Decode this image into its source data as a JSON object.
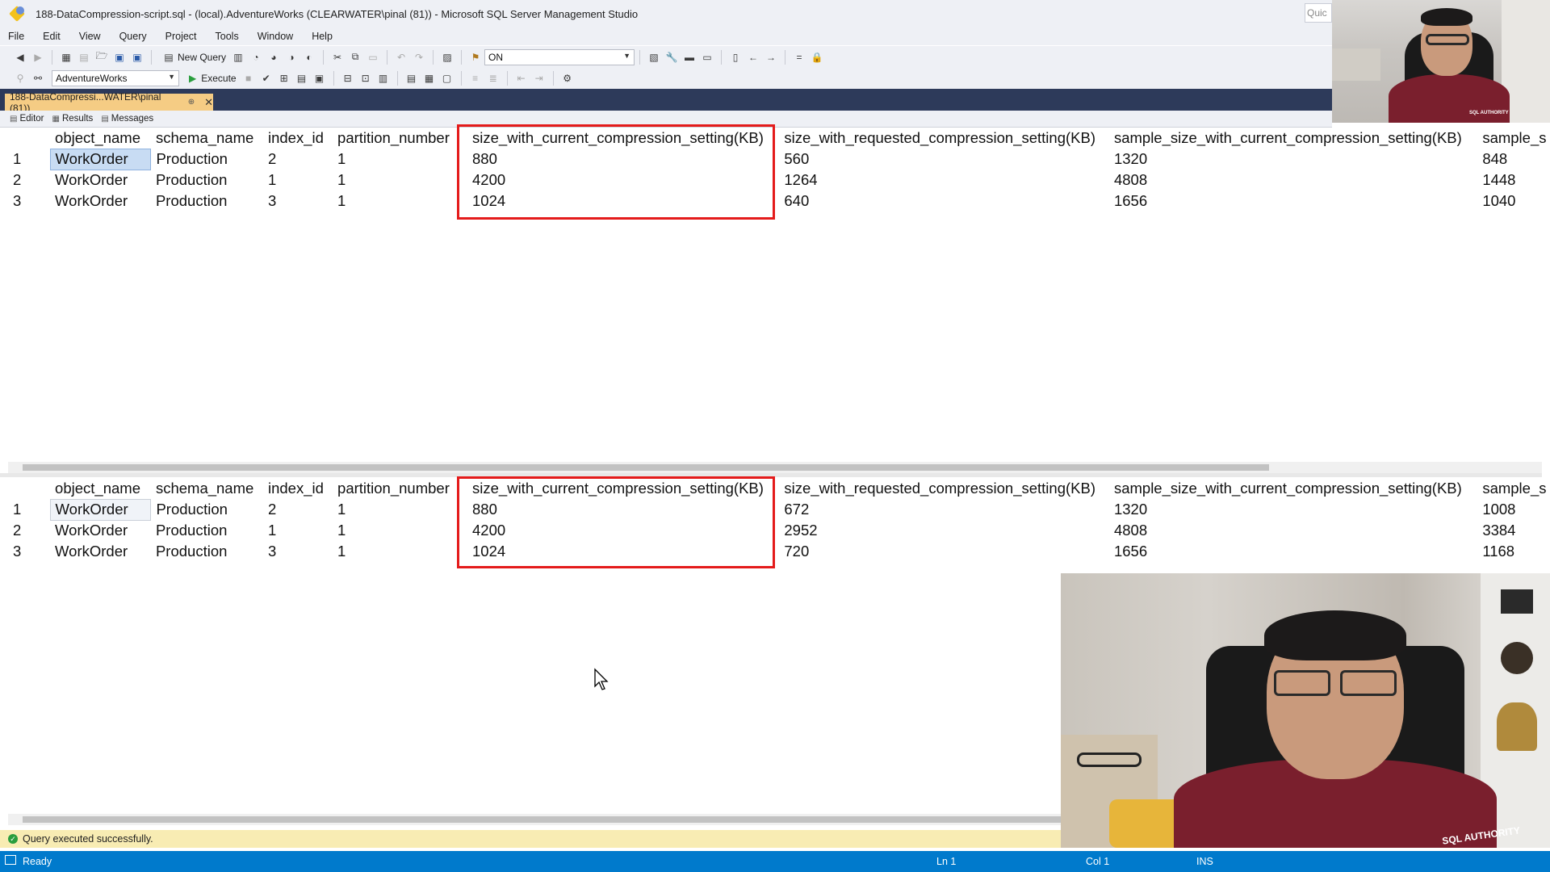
{
  "window": {
    "title": "188-DataCompression-script.sql - (local).AdventureWorks (CLEARWATER\\pinal (81)) - Microsoft SQL Server Management Studio",
    "quick_launch": "Quic"
  },
  "menu": [
    "File",
    "Edit",
    "View",
    "Query",
    "Project",
    "Tools",
    "Window",
    "Help"
  ],
  "toolbar": {
    "new_query_label": "New Query",
    "solution_config_value": "ON",
    "database_value": "AdventureWorks",
    "execute_label": "Execute"
  },
  "doc_tab": {
    "label": "188-DataCompressi...WATER\\pinal (81))",
    "pin": "⊕",
    "close": "✕"
  },
  "sub_tabs": {
    "editor": "Editor",
    "results": "Results",
    "messages": "Messages"
  },
  "grid1": {
    "columns": [
      "object_name",
      "schema_name",
      "index_id",
      "partition_number",
      "size_with_current_compression_setting(KB)",
      "size_with_requested_compression_setting(KB)",
      "sample_size_with_current_compression_setting(KB)",
      "sample_s"
    ],
    "rows": [
      {
        "n": "1",
        "object_name": "WorkOrder",
        "schema_name": "Production",
        "index_id": "2",
        "partition_number": "1",
        "current": "880",
        "requested": "560",
        "sample_current": "1320",
        "sample_s": "848"
      },
      {
        "n": "2",
        "object_name": "WorkOrder",
        "schema_name": "Production",
        "index_id": "1",
        "partition_number": "1",
        "current": "4200",
        "requested": "1264",
        "sample_current": "4808",
        "sample_s": "1448"
      },
      {
        "n": "3",
        "object_name": "WorkOrder",
        "schema_name": "Production",
        "index_id": "3",
        "partition_number": "1",
        "current": "1024",
        "requested": "640",
        "sample_current": "1656",
        "sample_s": "1040"
      }
    ]
  },
  "grid2": {
    "columns": [
      "object_name",
      "schema_name",
      "index_id",
      "partition_number",
      "size_with_current_compression_setting(KB)",
      "size_with_requested_compression_setting(KB)",
      "sample_size_with_current_compression_setting(KB)",
      "sample_s"
    ],
    "rows": [
      {
        "n": "1",
        "object_name": "WorkOrder",
        "schema_name": "Production",
        "index_id": "2",
        "partition_number": "1",
        "current": "880",
        "requested": "672",
        "sample_current": "1320",
        "sample_s": "1008"
      },
      {
        "n": "2",
        "object_name": "WorkOrder",
        "schema_name": "Production",
        "index_id": "1",
        "partition_number": "1",
        "current": "4200",
        "requested": "2952",
        "sample_current": "4808",
        "sample_s": "3384"
      },
      {
        "n": "3",
        "object_name": "WorkOrder",
        "schema_name": "Production",
        "index_id": "3",
        "partition_number": "1",
        "current": "1024",
        "requested": "720",
        "sample_current": "1656",
        "sample_s": "1168"
      }
    ]
  },
  "query_status": "Query executed successfully.",
  "statusbar": {
    "ready": "Ready",
    "line": "Ln 1",
    "col": "Col 1",
    "mode": "INS"
  },
  "webcam_small_text": "SQL AUTHORITY",
  "webcam_large_text": "SQL AUTHORITY",
  "colors": {
    "highlight_box": "#e41b1b",
    "status_blue": "#007acc",
    "tab_strip": "#2d3a5a",
    "active_tab": "#f5cc84",
    "selection": "#c8dcf3"
  }
}
